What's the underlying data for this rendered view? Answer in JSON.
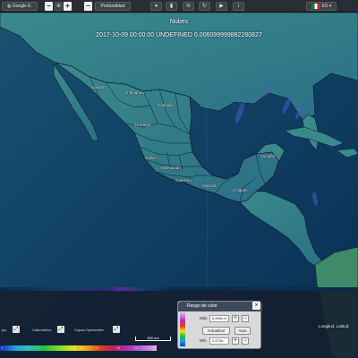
{
  "toolbar": {
    "basemap_label": "Google E.",
    "depth_label": "Profundidad",
    "language_label": "ES",
    "depth_minus": "−",
    "zoom_plus": "+",
    "zoom_minus": "−",
    "icons": [
      "drop-icon",
      "chart-icon",
      "layers-icon",
      "refresh-icon",
      "play-icon",
      "info-icon"
    ]
  },
  "map": {
    "layer_title": "Nubes",
    "layer_info": "2017-10-09 00:00:00 UNDEFINED 0.006099999882280827",
    "states": [
      "Sonora",
      "Chihuahua",
      "Coahuila",
      "Durango",
      "Jalisco",
      "Michoacán",
      "Guerrero",
      "Oaxaca",
      "Chiapas",
      "Yucatán"
    ]
  },
  "bottom": {
    "controls": [
      {
        "label": "jos"
      },
      {
        "label": "Calendarios"
      },
      {
        "label": "Capas Opcionales"
      }
    ],
    "scale_label": "500 km",
    "colorbar_ticks": [
      "0",
      "0.5",
      "1",
      "1.5",
      "2",
      "3",
      "4",
      "5",
      "6",
      "7",
      "8",
      "9",
      "10",
      "11",
      "12",
      "14",
      "16"
    ],
    "coords_label": "Longitud:",
    "coords_value": "Latitud:"
  },
  "color_dialog": {
    "title": "Rango de color",
    "max_label": "Máx",
    "max_value": "6.855e-6",
    "min_label": "Mín",
    "min_value": "2.679e-",
    "update_label": "Actualizar",
    "auto_label": "Auto",
    "plus": "+",
    "minus": "−",
    "close": "×"
  },
  "colors": {
    "ocean": "#0e3a5c",
    "land": "#2f7a8a",
    "toolbar": "#2a2e33"
  }
}
